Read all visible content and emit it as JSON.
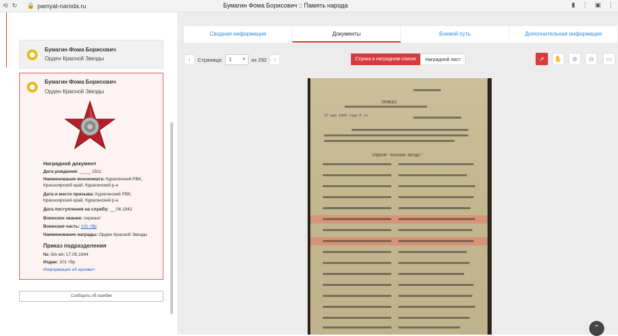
{
  "browser": {
    "url": "pamyat-naroda.ru",
    "title": "Бумагин Фома Борисович :: Память народа"
  },
  "left": {
    "card1": {
      "name": "Бумагин Фома Борисович",
      "award": "Орден Красной Звезды"
    },
    "card2": {
      "name": "Бумагин Фома Борисович",
      "award": "Орден Красной Звезды",
      "doc_heading": "Наградной документ",
      "fields": [
        {
          "label": "Дата рождения:",
          "value": "__.__.1911"
        },
        {
          "label": "Наименование военкомата:",
          "value": "Курагинский РВК, Красноярский край, Курагинский р-н"
        },
        {
          "label": "Дата и место призыва:",
          "value": "Курагинский РВК, Красноярский край, Курагинский р-н"
        },
        {
          "label": "Дата поступления на службу:",
          "value": "__.06.1942"
        },
        {
          "label": "Воинское звание:",
          "value": "сержант"
        },
        {
          "label": "Воинская часть:",
          "value": "101 тбр"
        },
        {
          "label": "Наименование награды:",
          "value": "Орден Красной Звезды"
        }
      ],
      "order_heading": "Приказ подразделения",
      "order_fields": [
        {
          "label": "№:",
          "value": "8/н",
          "label2": "от:",
          "value2": "17.05.1944"
        },
        {
          "label": "Издан:",
          "value": "101 тбр"
        }
      ],
      "archive_link": "Информация об архиве+"
    },
    "report_button": "Сообщить об ошибке"
  },
  "tabs": [
    {
      "label": "Сводная информация",
      "active": false
    },
    {
      "label": "Документы",
      "active": true
    },
    {
      "label": "Боевой путь",
      "active": false
    },
    {
      "label": "Дополнительная информация",
      "active": false
    }
  ],
  "pager": {
    "label": "Страница:",
    "current": "1",
    "total_text": "из 292"
  },
  "view_toggle": {
    "on": "Строка в наградном списке",
    "off": "Наградной лист"
  },
  "accent": "#d83b3b",
  "doc_text": {
    "order": "ПРИКАЗ",
    "date_line": "17 мая 1944 года    8 /н",
    "section": "ОРДЕНОМ \"КРАСНАЯ ЗВЕЗДА\""
  }
}
